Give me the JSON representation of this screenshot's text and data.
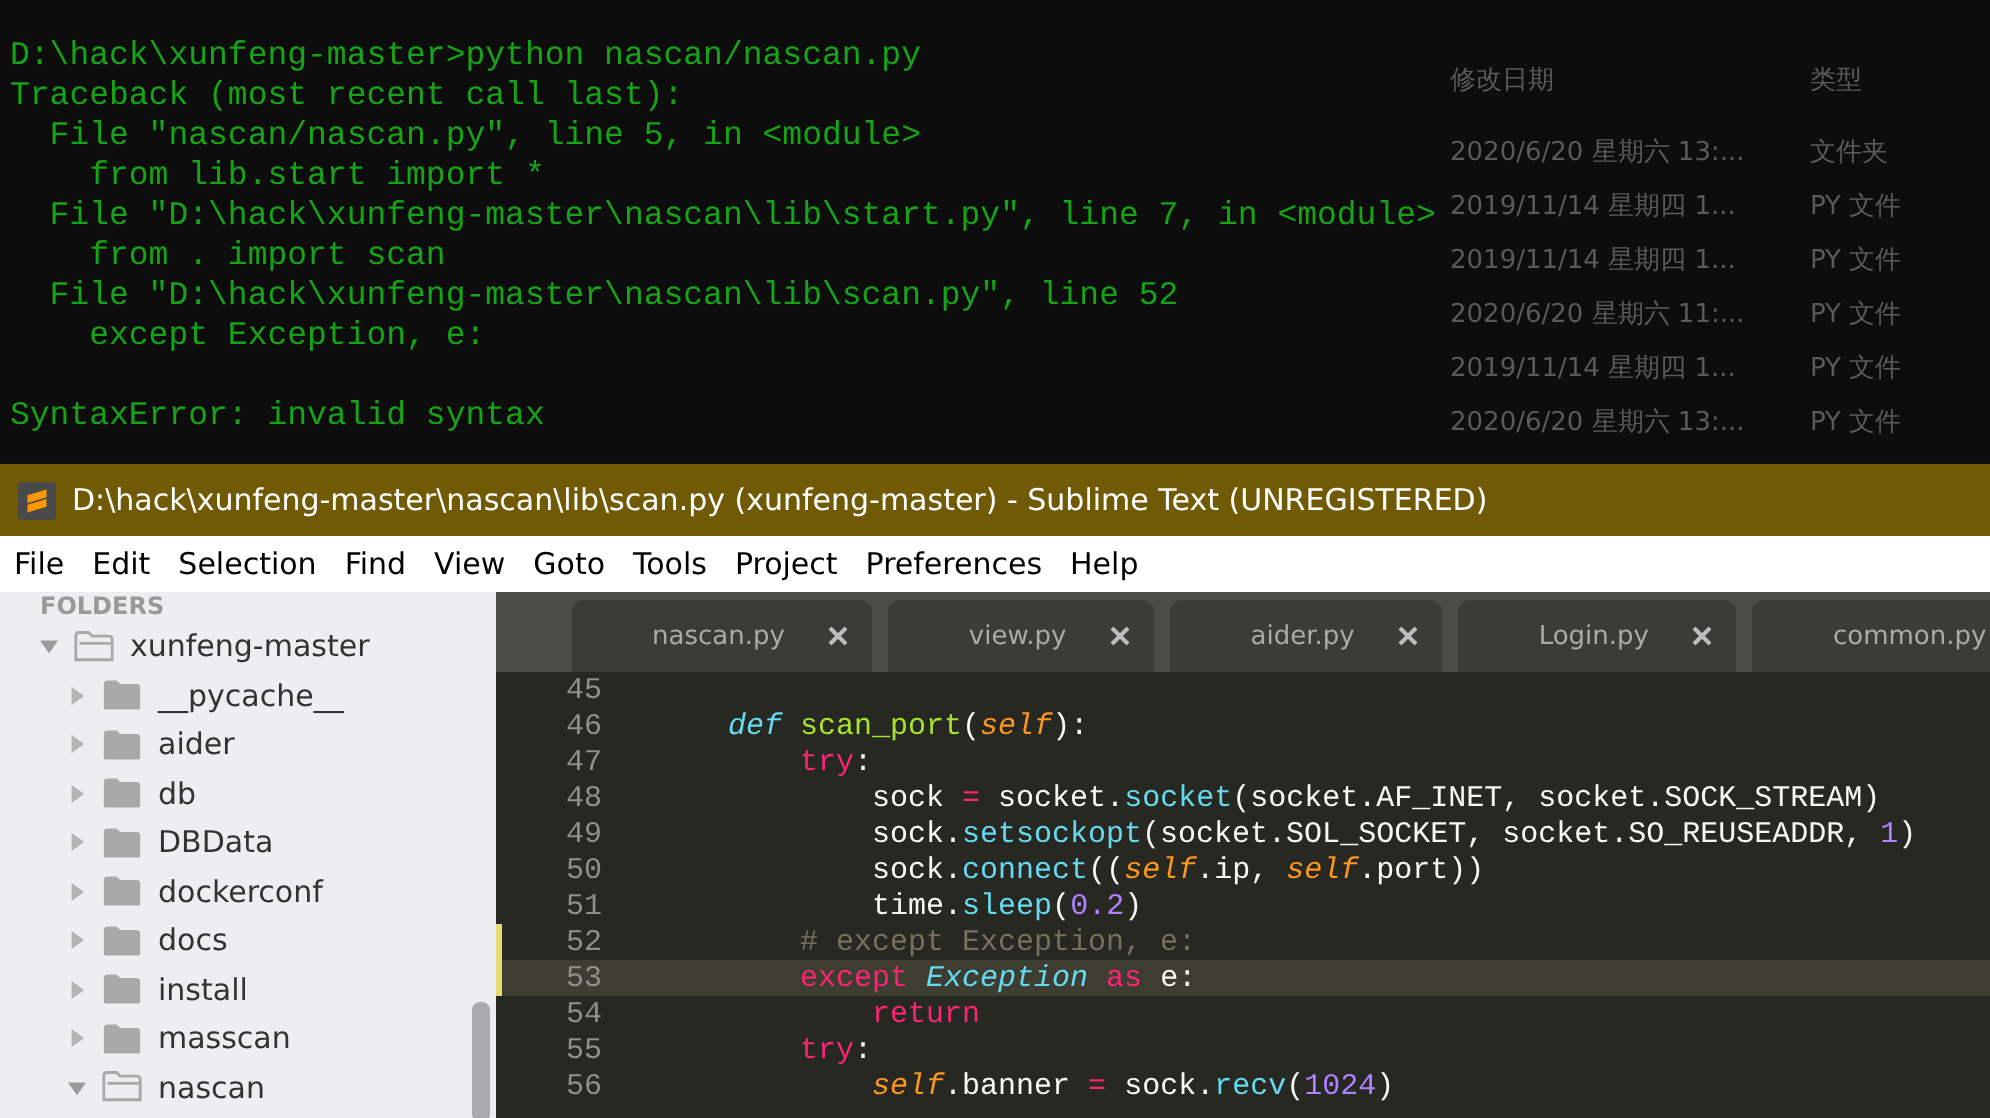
{
  "terminal": {
    "lines": [
      {
        "kind": "output",
        "text": "D:\\hack\\xunfeng-master>python nascan/nascan.py"
      },
      {
        "kind": "output",
        "text": "Traceback (most recent call last):"
      },
      {
        "kind": "output",
        "text": "  File \"nascan/nascan.py\", line 5, in <module>"
      },
      {
        "kind": "output",
        "text": "    from lib.start import *"
      },
      {
        "kind": "output",
        "text": "  File \"D:\\hack\\xunfeng-master\\nascan\\lib\\start.py\", line 7, in <module>"
      },
      {
        "kind": "output",
        "text": "    from . import scan"
      },
      {
        "kind": "output",
        "text": "  File \"D:\\hack\\xunfeng-master\\nascan\\lib\\scan.py\", line 52"
      },
      {
        "kind": "output",
        "text": "    except Exception, e:"
      },
      {
        "kind": "error",
        "text": "SyntaxError: invalid syntax"
      }
    ]
  },
  "explorer": {
    "columns": [
      "修改日期",
      "类型"
    ],
    "rows": [
      {
        "date": "2020/6/20 星期六 13:...",
        "type": "文件夹"
      },
      {
        "date": "2019/11/14 星期四 1...",
        "type": "PY 文件"
      },
      {
        "date": "2019/11/14 星期四 1...",
        "type": "PY 文件"
      },
      {
        "date": "2020/6/20 星期六 11:...",
        "type": "PY 文件"
      },
      {
        "date": "2019/11/14 星期四 1...",
        "type": "PY 文件"
      },
      {
        "date": "2020/6/20 星期六 13:...",
        "type": "PY 文件"
      }
    ]
  },
  "window": {
    "title": "D:\\hack\\xunfeng-master\\nascan\\lib\\scan.py (xunfeng-master) - Sublime Text (UNREGISTERED)"
  },
  "menu": [
    "File",
    "Edit",
    "Selection",
    "Find",
    "View",
    "Goto",
    "Tools",
    "Project",
    "Preferences",
    "Help"
  ],
  "sidebar": {
    "header": "FOLDERS",
    "items": [
      {
        "label": "xunfeng-master",
        "expanded": true,
        "children": [
          {
            "label": "__pycache__",
            "expanded": false
          },
          {
            "label": "aider",
            "expanded": false
          },
          {
            "label": "db",
            "expanded": false
          },
          {
            "label": "DBData",
            "expanded": false
          },
          {
            "label": "dockerconf",
            "expanded": false
          },
          {
            "label": "docs",
            "expanded": false
          },
          {
            "label": "install",
            "expanded": false
          },
          {
            "label": "masscan",
            "expanded": false
          },
          {
            "label": "nascan",
            "expanded": true
          }
        ]
      }
    ]
  },
  "tabs": [
    {
      "label": "nascan.py",
      "selected": false
    },
    {
      "label": "view.py",
      "selected": false
    },
    {
      "label": "aider.py",
      "selected": false
    },
    {
      "label": "Login.py",
      "selected": false
    },
    {
      "label": "common.py",
      "selected": false
    }
  ],
  "code": [
    {
      "number": "45",
      "modified": false,
      "current": false
    },
    {
      "number": "46",
      "modified": false,
      "current": false,
      "tokens": [
        {
          "kind": "storage",
          "text": "    def "
        },
        {
          "kind": "function",
          "text": "scan_port"
        },
        {
          "kind": "plain",
          "text": "("
        },
        {
          "kind": "self",
          "text": "self"
        },
        {
          "kind": "plain",
          "text": "):"
        }
      ]
    },
    {
      "number": "47",
      "modified": false,
      "current": false,
      "tokens": [
        {
          "kind": "keyword",
          "text": "        try"
        },
        {
          "kind": "plain",
          "text": ":"
        }
      ]
    },
    {
      "number": "48",
      "modified": false,
      "current": false,
      "tokens": [
        {
          "kind": "plain",
          "text": "            sock "
        },
        {
          "kind": "keyword",
          "text": "= "
        },
        {
          "kind": "plain",
          "text": "socket."
        },
        {
          "kind": "call",
          "text": "socket"
        },
        {
          "kind": "plain",
          "text": "(socket.AF_INET, socket.SOCK_STREAM)"
        }
      ]
    },
    {
      "number": "49",
      "modified": false,
      "current": false,
      "tokens": [
        {
          "kind": "plain",
          "text": "            sock."
        },
        {
          "kind": "call",
          "text": "setsockopt"
        },
        {
          "kind": "plain",
          "text": "(socket.SOL_SOCKET, socket.SO_REUSEADDR, "
        },
        {
          "kind": "number",
          "text": "1"
        },
        {
          "kind": "plain",
          "text": ")"
        }
      ]
    },
    {
      "number": "50",
      "modified": false,
      "current": false,
      "tokens": [
        {
          "kind": "plain",
          "text": "            sock."
        },
        {
          "kind": "call",
          "text": "connect"
        },
        {
          "kind": "plain",
          "text": "(("
        },
        {
          "kind": "self",
          "text": "self"
        },
        {
          "kind": "plain",
          "text": ".ip, "
        },
        {
          "kind": "self",
          "text": "self"
        },
        {
          "kind": "plain",
          "text": ".port))"
        }
      ]
    },
    {
      "number": "51",
      "modified": false,
      "current": false,
      "tokens": [
        {
          "kind": "plain",
          "text": "            time."
        },
        {
          "kind": "call",
          "text": "sleep"
        },
        {
          "kind": "plain",
          "text": "("
        },
        {
          "kind": "number",
          "text": "0.2"
        },
        {
          "kind": "plain",
          "text": ")"
        }
      ]
    },
    {
      "number": "52",
      "modified": true,
      "current": false,
      "tokens": [
        {
          "kind": "comment",
          "text": "        # except Exception, e:"
        }
      ]
    },
    {
      "number": "53",
      "modified": true,
      "current": true,
      "tokens": [
        {
          "kind": "keyword",
          "text": "        except "
        },
        {
          "kind": "class",
          "text": "Exception"
        },
        {
          "kind": "keyword",
          "text": " as"
        },
        {
          "kind": "plain",
          "text": " e:"
        }
      ]
    },
    {
      "number": "54",
      "modified": false,
      "current": false,
      "tokens": [
        {
          "kind": "keyword",
          "text": "            return"
        }
      ]
    },
    {
      "number": "55",
      "modified": false,
      "current": false,
      "tokens": [
        {
          "kind": "keyword",
          "text": "        try"
        },
        {
          "kind": "plain",
          "text": ":"
        }
      ]
    },
    {
      "number": "56",
      "modified": false,
      "current": false,
      "tokens": [
        {
          "kind": "self",
          "text": "            self"
        },
        {
          "kind": "plain",
          "text": ".banner "
        },
        {
          "kind": "keyword",
          "text": "= "
        },
        {
          "kind": "plain",
          "text": "sock."
        },
        {
          "kind": "call",
          "text": "recv"
        },
        {
          "kind": "plain",
          "text": "("
        },
        {
          "kind": "number",
          "text": "1024"
        },
        {
          "kind": "plain",
          "text": ")"
        }
      ]
    }
  ]
}
